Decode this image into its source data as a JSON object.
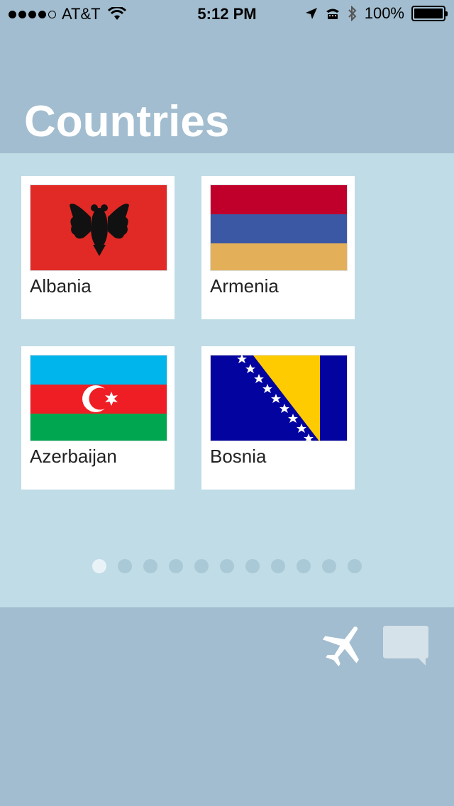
{
  "status_bar": {
    "carrier": "AT&T",
    "time": "5:12 PM",
    "battery": "100%"
  },
  "header": {
    "title": "Countries"
  },
  "countries": [
    {
      "name": "Albania"
    },
    {
      "name": "Armenia"
    },
    {
      "name": "Azerbaijan"
    },
    {
      "name": "Bosnia"
    }
  ],
  "pager": {
    "total": 11,
    "active": 0
  },
  "colors": {
    "background": "#a2bdcf",
    "panel": "#bfdce7",
    "title": "#ffffff"
  },
  "icons": {
    "flight": "airplane-icon",
    "messages": "chat-bubble-icon"
  }
}
